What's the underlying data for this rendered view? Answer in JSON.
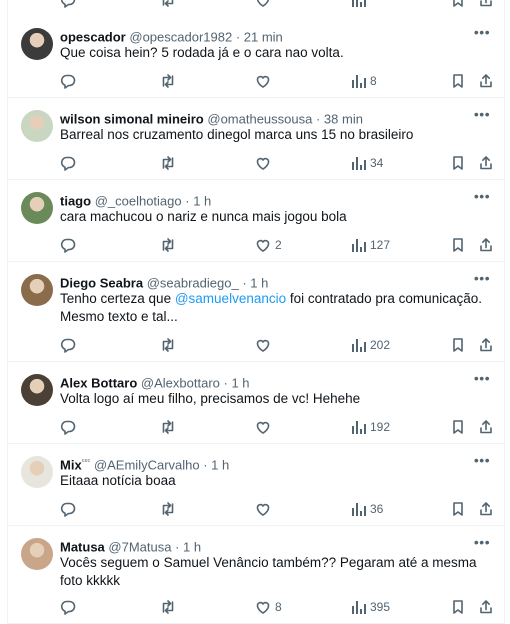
{
  "tweets": [
    {
      "name": "opescador",
      "badge": "",
      "handle": "@opescador1982",
      "time": "21 min",
      "text": "Que coisa hein? 5 rodada já e o cara nao volta.",
      "replies": "",
      "retweets": "",
      "likes": "",
      "views": "8",
      "avatar_color": "#3b3b3b"
    },
    {
      "name": "wilson simonal mineiro",
      "badge": "",
      "handle": "@omatheussousa",
      "time": "38 min",
      "text": "Barreal nos cruzamento dinegol marca uns 15 no brasileiro",
      "replies": "",
      "retweets": "",
      "likes": "",
      "views": "34",
      "avatar_color": "#c8d6c2"
    },
    {
      "name": "tiago",
      "badge": "",
      "handle": "@_coelhotiago",
      "time": "1 h",
      "text": "cara machucou o nariz e nunca mais jogou bola",
      "replies": "",
      "retweets": "",
      "likes": "2",
      "views": "127",
      "avatar_color": "#6b8a5a"
    },
    {
      "name": "Diego Seabra",
      "badge": "",
      "handle": "@seabradiego_",
      "time": "1 h",
      "text_before": "Tenho certeza que ",
      "mention": "@samuelvenancio",
      "text_after": " foi contratado pra comunicação. Mesmo texto e tal...",
      "replies": "",
      "retweets": "",
      "likes": "",
      "views": "202",
      "avatar_color": "#8a6b4a"
    },
    {
      "name": "Alex Bottaro",
      "badge": "",
      "handle": "@Alexbottaro",
      "time": "1 h",
      "text": "Volta logo aí meu filho, precisamos de vc! Hehehe",
      "replies": "",
      "retweets": "",
      "likes": "",
      "views": "192",
      "avatar_color": "#4a4036"
    },
    {
      "name": "Mix",
      "badge": "ᶜᵉᶜ",
      "handle": "@AEmilyCarvalho",
      "time": "1 h",
      "text": "Eitaaa notícia boaa",
      "replies": "",
      "retweets": "",
      "likes": "",
      "views": "36",
      "avatar_color": "#e8e4de"
    },
    {
      "name": "Matusa",
      "badge": "",
      "handle": "@7Matusa",
      "time": "1 h",
      "text": "Vocês seguem o Samuel Venâncio também?? Pegaram até a mesma foto kkkkk",
      "replies": "",
      "retweets": "",
      "likes": "8",
      "views": "395",
      "avatar_color": "#c9a58a"
    }
  ],
  "separator": " · ",
  "colors": {
    "text": "#0f1419",
    "secondary": "#536471",
    "link": "#1d9bf0",
    "divider": "#eff3f4"
  },
  "icons": [
    "reply-icon",
    "retweet-icon",
    "like-icon",
    "views-icon",
    "bookmark-icon",
    "share-icon",
    "more-icon"
  ]
}
